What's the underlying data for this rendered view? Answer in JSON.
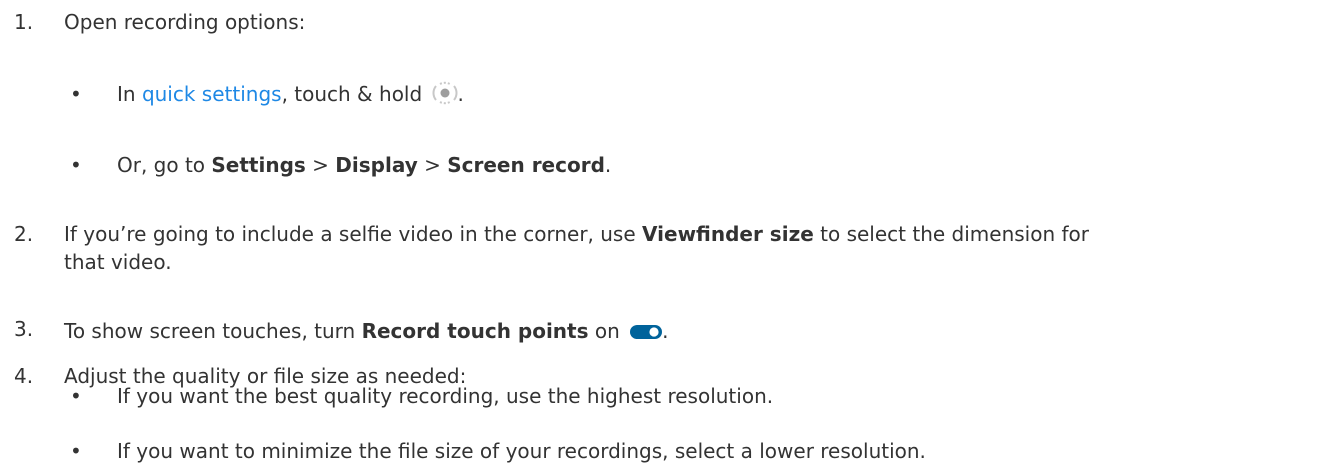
{
  "steps": [
    {
      "number": "1.",
      "text": "Open recording options:",
      "bullets": [
        {
          "prefix": "In ",
          "link": "quick settings",
          "after_link": ", touch & hold ",
          "icon": "screen-record-icon",
          "suffix": "."
        },
        {
          "prefix": "Or, go to ",
          "path": [
            "Settings",
            "Display",
            "Screen record"
          ],
          "separator": " > ",
          "suffix": "."
        }
      ]
    },
    {
      "number": "2.",
      "prefix": "If you’re going to include a selfie video in the corner, use ",
      "bold": "Viewfinder size",
      "suffix": " to select the dimension for",
      "line2": "that video."
    },
    {
      "number": "3.",
      "prefix": "To show screen touches, turn ",
      "bold": "Record touch points",
      "after_bold": " on ",
      "icon": "toggle-on-icon",
      "suffix": "."
    },
    {
      "number": "4.",
      "text": "Adjust the quality or file size as needed:",
      "bullets": [
        {
          "text": "If you want the best quality recording, use the highest resolution."
        },
        {
          "text": "If you want to minimize the file size of your recordings, select a lower resolution."
        }
      ]
    }
  ],
  "bullet_glyph": "•",
  "colors": {
    "text": "#333333",
    "link": "#1e88e5",
    "toggle_track": "#00639b",
    "toggle_thumb": "#ffffff",
    "icon_gray": "#9e9e9e"
  }
}
